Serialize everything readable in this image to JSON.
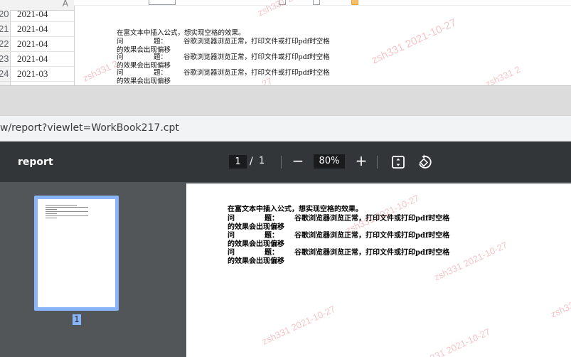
{
  "spreadsheet": {
    "column_header": "A",
    "rows": [
      {
        "num": "20",
        "value": "2021-04"
      },
      {
        "num": "21",
        "value": "2021-04"
      },
      {
        "num": "22",
        "value": "2021-04"
      },
      {
        "num": "23",
        "value": "2021-04"
      },
      {
        "num": "24",
        "value": "2021-03"
      }
    ]
  },
  "document": {
    "line1": "在富文本中插入公式，想实现空格的效果。",
    "q_label_1": "问",
    "q_label_2": "题：",
    "answer_text": "谷歌浏览器浏览正常，打印文件或打印pdf时空格",
    "line_continued": "的效果会出现偏移",
    "watermark": "zsh331 2021-10-27",
    "watermark_fragment_1": "zsh331 2",
    "watermark_fragment_2": "-27"
  },
  "browser": {
    "url": "w/report?viewlet=WorkBook217.cpt"
  },
  "pdf_viewer": {
    "title": "report",
    "current_page": "1",
    "page_separator": "/",
    "total_pages": "1",
    "zoom_minus": "−",
    "zoom_level": "80%",
    "zoom_plus": "+",
    "thumbnail_page_label": "1",
    "icons": [
      "zoom-out-icon",
      "zoom-in-icon",
      "fit-page-icon",
      "rotate-icon"
    ]
  },
  "colors": {
    "toolbar_bg": "#323639",
    "viewer_bg": "#525659",
    "thumbnail_highlight": "#8ab4f8",
    "watermark": "#e15a64"
  }
}
